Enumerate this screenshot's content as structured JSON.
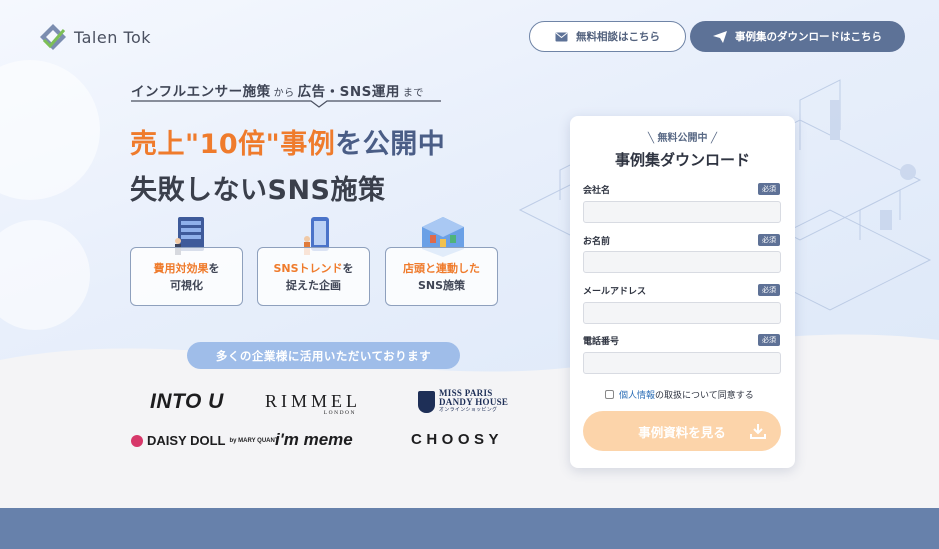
{
  "header": {
    "logo_text": "Talen Tok",
    "consult_label": "無料相談はこちら",
    "download_label": "事例集のダウンロードはこちら"
  },
  "hero": {
    "tagline_a": "インフルエンサー施策",
    "tagline_from": "から",
    "tagline_b": "広告・SNS運用",
    "tagline_to": "まで",
    "headline1_orange": "売上\"10倍\"事例",
    "headline1_blue": "を公開中",
    "headline2": "失敗しないSNS施策"
  },
  "features": [
    {
      "highlight": "費用対効果",
      "rest1": "を",
      "line2": "可視化"
    },
    {
      "highlight": "SNSトレンド",
      "rest1": "を",
      "line2": "捉えた企画"
    },
    {
      "highlight": "店頭と連動した",
      "rest1": "",
      "line2": "SNS施策"
    }
  ],
  "clients": {
    "pill": "多くの企業様に活用いただいております",
    "brands": {
      "intou": "INTO U",
      "rimmel": "RIMMEL",
      "rimmel_sub": "LONDON",
      "missparis_1": "MISS PARIS",
      "missparis_2": "DANDY HOUSE",
      "missparis_3": "オンラインショッピング",
      "daisy": "DAISY DOLL",
      "daisy_sub": "by MARY QUANT",
      "imme": "i'm meme",
      "choosy": "CHOOSY"
    }
  },
  "form": {
    "kicker": "無料公開中",
    "title": "事例集ダウンロード",
    "required_label": "必須",
    "fields": [
      {
        "label": "会社名",
        "value": ""
      },
      {
        "label": "お名前",
        "value": ""
      },
      {
        "label": "メールアドレス",
        "value": ""
      },
      {
        "label": "電話番号",
        "value": ""
      }
    ],
    "consent_link": "個人情報",
    "consent_rest": "の取扱について同意する",
    "submit_label": "事例資料を見る"
  },
  "colors": {
    "accent_orange": "#ef7b2c",
    "navy": "#5d7297",
    "submit": "#fcd4aa",
    "band": "#6781ab"
  }
}
